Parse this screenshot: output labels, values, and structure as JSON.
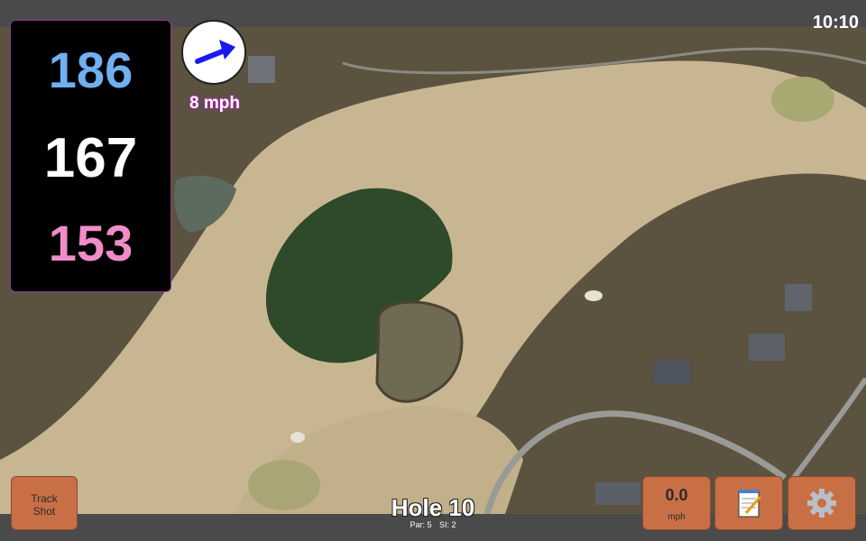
{
  "status": {
    "time": "10:10"
  },
  "yardage": {
    "back": "186",
    "middle": "167",
    "front": "153",
    "colors": {
      "back": "#6fb0f0",
      "middle": "#ffffff",
      "front": "#f08cc8"
    }
  },
  "wind": {
    "speed_label": "8 mph",
    "arrow_icon": "arrow-icon"
  },
  "hole": {
    "title": "Hole 10",
    "par": "Par: 5",
    "si": "SI: 2"
  },
  "buttons": {
    "track_shot_line1": "Track",
    "track_shot_line2": "Shot",
    "speed_value": "0.0",
    "speed_unit": "mph",
    "notes_icon": "notepad-icon",
    "settings_icon": "gear-icon"
  },
  "colors": {
    "button_bg": "#c96f46",
    "panel_border": "#8a3a8a"
  }
}
